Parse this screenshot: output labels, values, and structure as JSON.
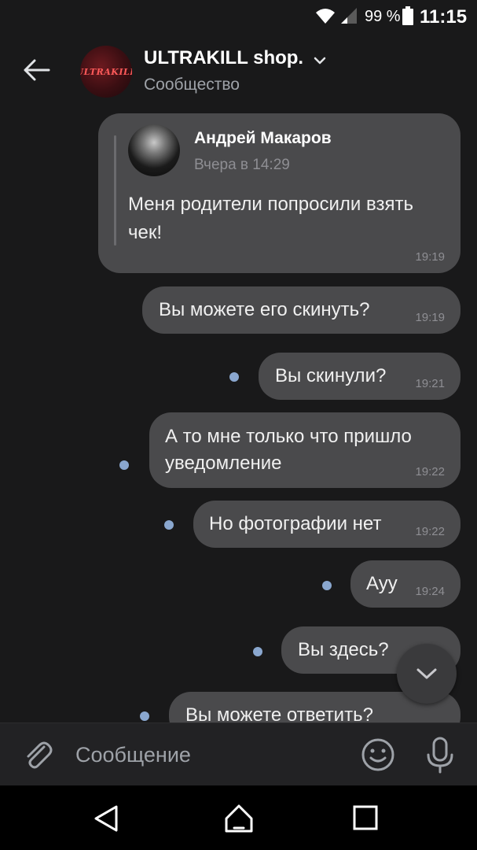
{
  "status_bar": {
    "battery_percent": "99 %",
    "time": "11:15"
  },
  "header": {
    "title": "ULTRAKILL shop.",
    "subtitle": "Сообщество",
    "avatar_text": "ULTRAKILL"
  },
  "forwarded": {
    "author": "Андрей Макаров",
    "date": "Вчера в 14:29",
    "text": "Меня родители попросили взять чек!",
    "time": "19:19"
  },
  "messages": [
    {
      "text": "Вы можете его скинуть?",
      "time": "19:19",
      "unread": false
    },
    {
      "text": "Вы скинули?",
      "time": "19:21",
      "unread": true
    },
    {
      "text": "А то мне только что пришло уведомление",
      "time": "19:22",
      "unread": true
    },
    {
      "text": "Но фотографии нет",
      "time": "19:22",
      "unread": true
    },
    {
      "text": "Ауу",
      "time": "19:24",
      "unread": true
    },
    {
      "text": "Вы здесь?",
      "time": "",
      "unread": true
    },
    {
      "text": "Вы можете ответить?",
      "time": "",
      "unread": true
    }
  ],
  "composer": {
    "placeholder": "Сообщение"
  },
  "colors": {
    "background": "#19191a",
    "bubble": "#4a4a4c",
    "unread_dot": "#8aa7cf"
  }
}
